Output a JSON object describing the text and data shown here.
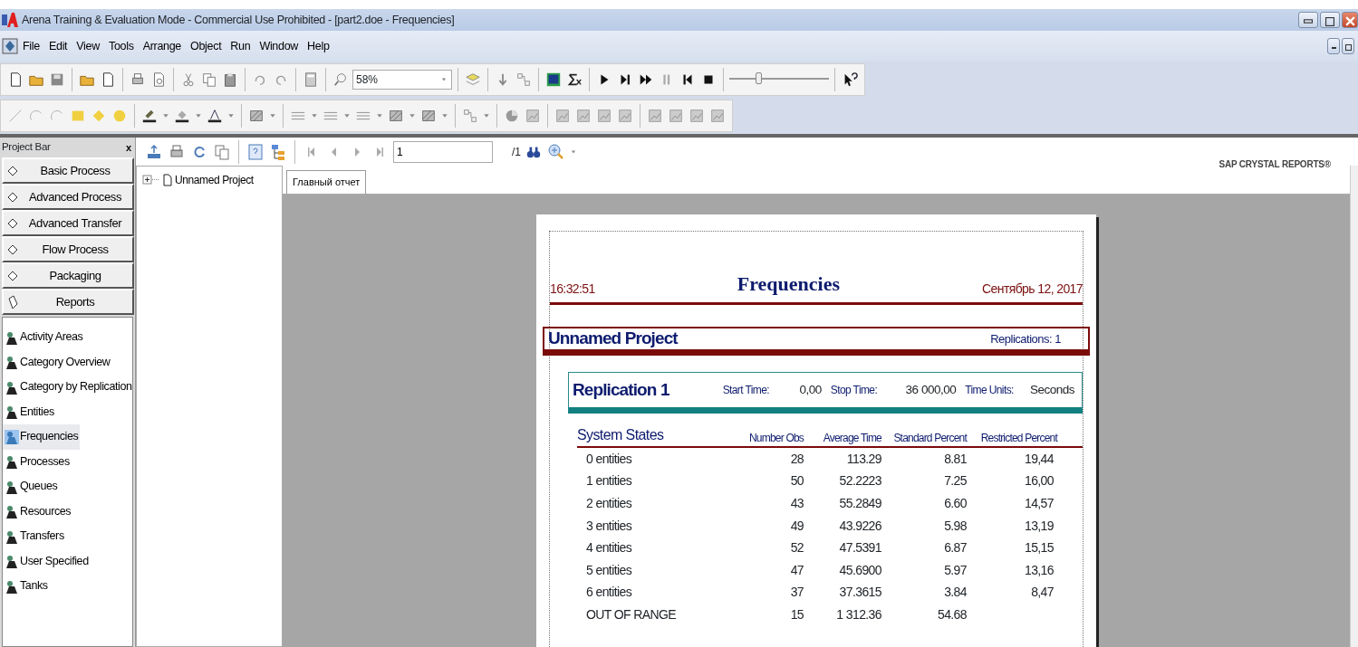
{
  "window": {
    "title": "Arena Training & Evaluation Mode - Commercial Use Prohibited - [part2.doe - Frequencies]"
  },
  "menu": [
    "File",
    "Edit",
    "View",
    "Tools",
    "Arrange",
    "Object",
    "Run",
    "Window",
    "Help"
  ],
  "toolbar": {
    "zoom": "58%",
    "speed_slider": {
      "level": 0.3
    }
  },
  "project_bar": {
    "title": "Project Bar",
    "close": "x",
    "panels": [
      {
        "label": "Basic Process",
        "kind": "template"
      },
      {
        "label": "Advanced Process",
        "kind": "template"
      },
      {
        "label": "Advanced Transfer",
        "kind": "template"
      },
      {
        "label": "Flow Process",
        "kind": "template"
      },
      {
        "label": "Packaging",
        "kind": "template"
      },
      {
        "label": "Reports",
        "kind": "reports"
      }
    ],
    "reports": [
      {
        "label": "Activity Areas",
        "selected": false
      },
      {
        "label": "Category Overview",
        "selected": false
      },
      {
        "label": "Category by Replication",
        "selected": false
      },
      {
        "label": "Entities",
        "selected": false
      },
      {
        "label": "Frequencies",
        "selected": true
      },
      {
        "label": "Processes",
        "selected": false
      },
      {
        "label": "Queues",
        "selected": false
      },
      {
        "label": "Resources",
        "selected": false
      },
      {
        "label": "Transfers",
        "selected": false
      },
      {
        "label": "User Specified",
        "selected": false
      },
      {
        "label": "Tanks",
        "selected": false
      }
    ]
  },
  "viewer": {
    "page_field": "1",
    "page_total": "/1",
    "brand": "SAP CRYSTAL REPORTS®",
    "tree": [
      {
        "label": "Unnamed Project",
        "expanded": false
      }
    ],
    "tabs": [
      {
        "label": "Главный отчет",
        "selected": true
      }
    ]
  },
  "report": {
    "time": "16:32:51",
    "title": "Frequencies",
    "date": "Сентябрь 12, 2017",
    "project": "Unnamed Project",
    "replications_label": "Replications:",
    "replications": "1",
    "replication": {
      "title": "Replication 1",
      "fields": [
        {
          "label": "Start Time:",
          "value": "0,00"
        },
        {
          "label": "Stop Time:",
          "value": "36 000,00"
        },
        {
          "label": "Time Units:",
          "value": "Seconds"
        }
      ]
    },
    "section": "System States",
    "columns": [
      "Number Obs",
      "Average Time",
      "Standard Percent",
      "Restricted Percent"
    ],
    "rows": [
      {
        "state": "0 entities",
        "values": [
          "28",
          "113.29",
          "8.81",
          "19,44"
        ]
      },
      {
        "state": "1 entities",
        "values": [
          "50",
          "52.2223",
          "7.25",
          "16,00"
        ]
      },
      {
        "state": "2 entities",
        "values": [
          "43",
          "55.2849",
          "6.60",
          "14,57"
        ]
      },
      {
        "state": "3 entities",
        "values": [
          "49",
          "43.9226",
          "5.98",
          "13,19"
        ]
      },
      {
        "state": "4 entities",
        "values": [
          "52",
          "47.5391",
          "6.87",
          "15,15"
        ]
      },
      {
        "state": "5 entities",
        "values": [
          "47",
          "45.6900",
          "5.97",
          "13,16"
        ]
      },
      {
        "state": "6 entities",
        "values": [
          "37",
          "37.3615",
          "3.84",
          "8,47"
        ]
      },
      {
        "state": "OUT OF RANGE",
        "values": [
          "15",
          "1 312.36",
          "54.68"
        ]
      }
    ]
  }
}
